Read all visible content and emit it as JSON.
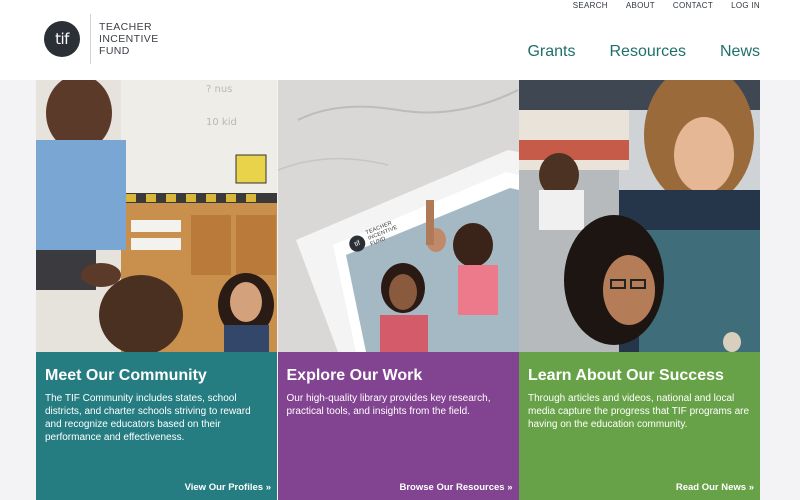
{
  "brand": {
    "logo_mark": "tif",
    "name_line1": "TEACHER",
    "name_line2": "INCENTIVE",
    "name_line3": "FUND"
  },
  "utility_nav": [
    "SEARCH",
    "ABOUT",
    "CONTACT",
    "LOG IN"
  ],
  "main_nav": [
    "Grants",
    "Resources",
    "News"
  ],
  "panels": [
    {
      "title": "Meet Our Community",
      "body": "The TIF Community includes states, school districts, and charter schools striving to reward and recognize educators based on their performance and effectiveness.",
      "cta": "View Our Profiles »",
      "color": "#147378"
    },
    {
      "title": "Explore Our Work",
      "body": "Our high-quality library provides key research, practical tools, and insights from the field.",
      "cta": "Browse Our Resources »",
      "color": "#793589",
      "tablet": {
        "logo_mark": "tif",
        "name_line1": "TEACHER",
        "name_line2": "INCENTIVE",
        "name_line3": "FUND"
      }
    },
    {
      "title": "Learn About Our Success",
      "body": "Through articles and videos, national and local media capture the progress that TIF programs are having on the education community.",
      "cta": "Read Our News »",
      "color": "#5c9b3a"
    }
  ],
  "chalkboard_text": [
    "? nus",
    "10 kid"
  ]
}
